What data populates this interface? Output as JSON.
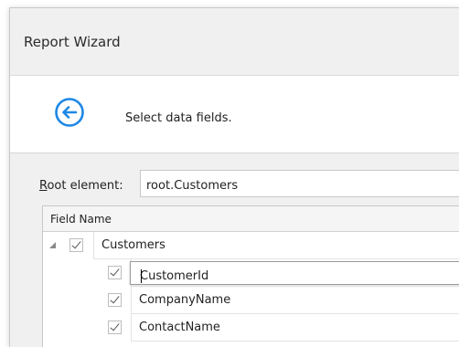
{
  "window": {
    "title": "Report Wizard"
  },
  "header": {
    "back_icon": "back-arrow-circle-icon",
    "text": "Select data fields.",
    "accent": "#1e88e5"
  },
  "root": {
    "label_prefix": "R",
    "label_rest": "oot element:",
    "value": "root.Customers"
  },
  "grid": {
    "column": "Field Name",
    "parent": {
      "label": "Customers",
      "checked": true,
      "expanded": true
    },
    "children": [
      {
        "label": "CustomerId",
        "checked": true,
        "editing": true
      },
      {
        "label": "CompanyName",
        "checked": true
      },
      {
        "label": "ContactName",
        "checked": true
      }
    ]
  }
}
